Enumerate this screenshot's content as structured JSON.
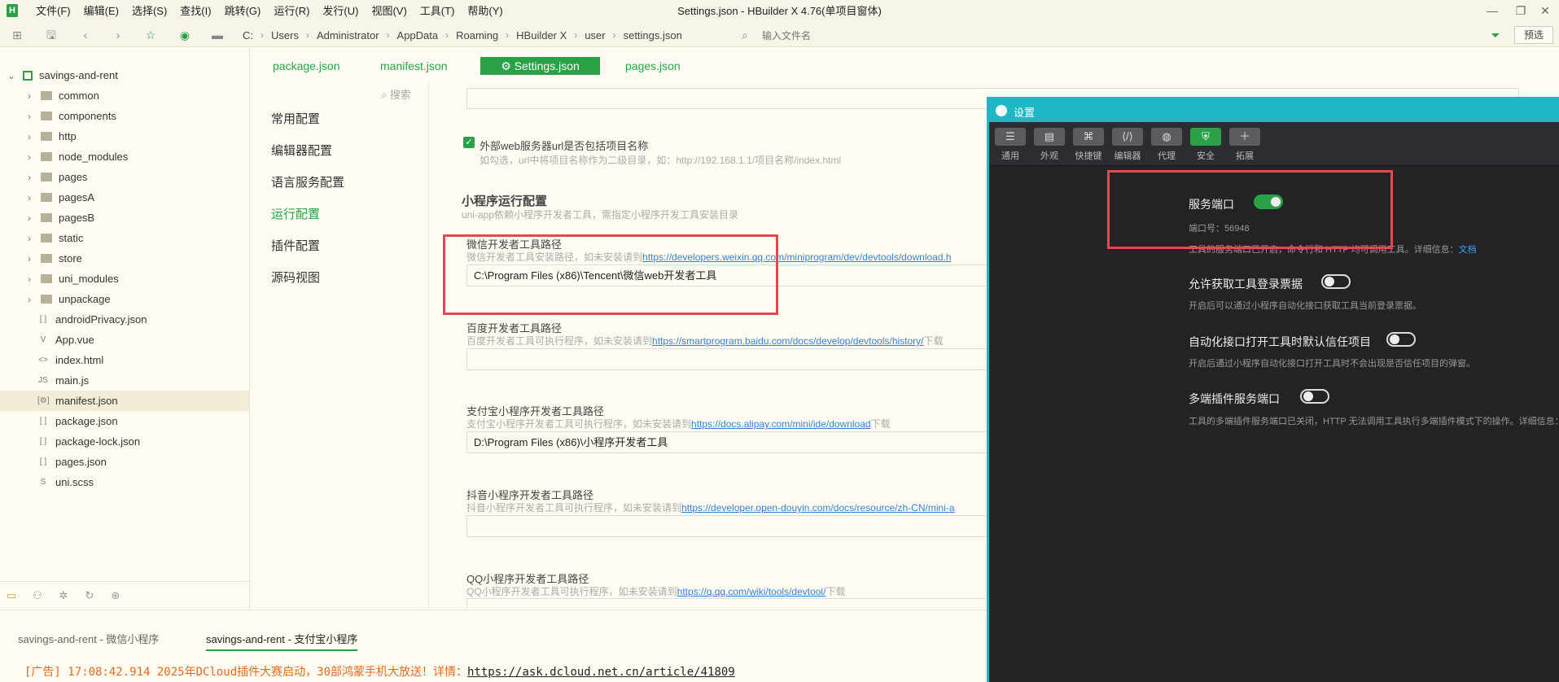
{
  "window": {
    "title": "Settings.json - HBuilder X 4.76(单项目窗体)",
    "logo": "H",
    "menus": [
      "文件(F)",
      "编辑(E)",
      "选择(S)",
      "查找(I)",
      "跳转(G)",
      "运行(R)",
      "发行(U)",
      "视图(V)",
      "工具(T)",
      "帮助(Y)"
    ],
    "controls": {
      "minimize": "—",
      "restore": "❐",
      "close": "✕"
    }
  },
  "toolbar": {
    "breadcrumb": [
      "C:",
      "Users",
      "Administrator",
      "AppData",
      "Roaming",
      "HBuilder X",
      "user",
      "settings.json"
    ],
    "file_input_placeholder": "输入文件名",
    "preview_label": "预选",
    "icons": [
      "new-file-icon",
      "save-icon",
      "back-icon",
      "forward-icon",
      "star-icon",
      "run-icon",
      "folder-icon",
      "find-file-icon",
      "filter-icon"
    ]
  },
  "sidebar": {
    "project": "savings-and-rent",
    "folders": [
      "common",
      "components",
      "http",
      "node_modules",
      "pages",
      "pagesA",
      "pagesB",
      "static",
      "store",
      "uni_modules",
      "unpackage"
    ],
    "files": [
      {
        "name": "androidPrivacy.json",
        "icon": "[ ]"
      },
      {
        "name": "App.vue",
        "icon": "V"
      },
      {
        "name": "index.html",
        "icon": "<>"
      },
      {
        "name": "main.js",
        "icon": "JS"
      },
      {
        "name": "manifest.json",
        "icon": "[⚙]"
      },
      {
        "name": "package.json",
        "icon": "[ ]"
      },
      {
        "name": "package-lock.json",
        "icon": "[ ]"
      },
      {
        "name": "pages.json",
        "icon": "[ ]"
      },
      {
        "name": "uni.scss",
        "icon": "S"
      }
    ],
    "selected": "manifest.json"
  },
  "editor_tabs": [
    "package.json",
    "manifest.json",
    "⚙ Settings.json",
    "pages.json"
  ],
  "settings_nav": {
    "search": "搜索",
    "items": [
      "常用配置",
      "编辑器配置",
      "语言服务配置",
      "运行配置",
      "插件配置",
      "源码视图"
    ],
    "active": "运行配置"
  },
  "settings_content": {
    "web_checkbox_label": "外部web服务器url是否包括项目名称",
    "web_checkbox_sub": "如勾选，url中将项目名称作为二级目录，如：http://192.168.1.1/项目名称/index.html",
    "mp_section_title": "小程序运行配置",
    "mp_section_sub": "uni-app依赖小程序开发者工具，需指定小程序开发工具安装目录",
    "weixin": {
      "label": "微信开发者工具路径",
      "sub": "微信开发者工具安装路径，如未安装请到",
      "link": "https://developers.weixin.qq.com/miniprogram/dev/devtools/download.h",
      "value": "C:\\Program Files (x86)\\Tencent\\微信web开发者工具"
    },
    "baidu": {
      "label": "百度开发者工具路径",
      "sub": "百度开发者工具可执行程序，如未安装请到",
      "link": "https://smartprogram.baidu.com/docs/develop/devtools/history/",
      "suffix": "下载",
      "value": ""
    },
    "alipay": {
      "label": "支付宝小程序开发者工具路径",
      "sub": "支付宝小程序开发者工具可执行程序，如未安装请到",
      "link": "https://docs.alipay.com/mini/ide/download",
      "suffix": "下载",
      "value": "D:\\Program Files (x86)\\小程序开发者工具"
    },
    "douyin": {
      "label": "抖音小程序开发者工具路径",
      "sub": "抖音小程序开发者工具可执行程序，如未安装请到",
      "link": "https://developer.open-douyin.com/docs/resource/zh-CN/mini-a",
      "value": ""
    },
    "qq": {
      "label": "QQ小程序开发者工具路径",
      "sub": "QQ小程序开发者工具可执行程序，如未安装请到",
      "link": "https://q.qq.com/wiki/tools/devtool/",
      "suffix": "下载"
    }
  },
  "console": {
    "tabs": [
      "savings-and-rent - 微信小程序",
      "savings-and-rent - 支付宝小程序"
    ],
    "active_tab": "savings-and-rent - 支付宝小程序",
    "line_prefix": "[广告] 17:08:42.914 2025年DCloud插件大赛启动，30部鸿蒙手机大放送！详情：",
    "line_link": "https://ask.dcloud.net.cn/article/41809"
  },
  "dialog": {
    "title": "设置",
    "tools": [
      {
        "label": "通用",
        "glyph": "☰"
      },
      {
        "label": "外观",
        "glyph": "▤"
      },
      {
        "label": "快捷键",
        "glyph": "⌘"
      },
      {
        "label": "编辑器",
        "glyph": "⟨/⟩"
      },
      {
        "label": "代理",
        "glyph": "◍"
      },
      {
        "label": "安全",
        "glyph": "⛨"
      },
      {
        "label": "拓展",
        "glyph": "＋"
      }
    ],
    "active_tool": "安全",
    "settings": [
      {
        "title": "服务端口",
        "sub": "端口号：56948",
        "on": true
      },
      {
        "sub_cont": "工具的服务端口已开启，命令行和 HTTP 均可调用工具。详细信息：",
        "link": "文档"
      },
      {
        "title": "允许获取工具登录票据",
        "sub": "开启后可以通过小程序自动化接口获取工具当前登录票据。",
        "on": false
      },
      {
        "title": "自动化接口打开工具时默认信任项目",
        "sub": "开启后通过小程序自动化接口打开工具时不会出现是否信任项目的弹窗。",
        "on": false
      },
      {
        "title": "多端插件服务端口",
        "sub": "工具的多端插件服务端口已关闭，HTTP 无法调用工具执行多端插件模式下的操作。详细信息：",
        "on": false
      }
    ]
  },
  "colors": {
    "accent": "#2aa147",
    "highlight_box": "#e8474b",
    "dialog_border": "#1db8c4",
    "link": "#3a7fd0"
  }
}
